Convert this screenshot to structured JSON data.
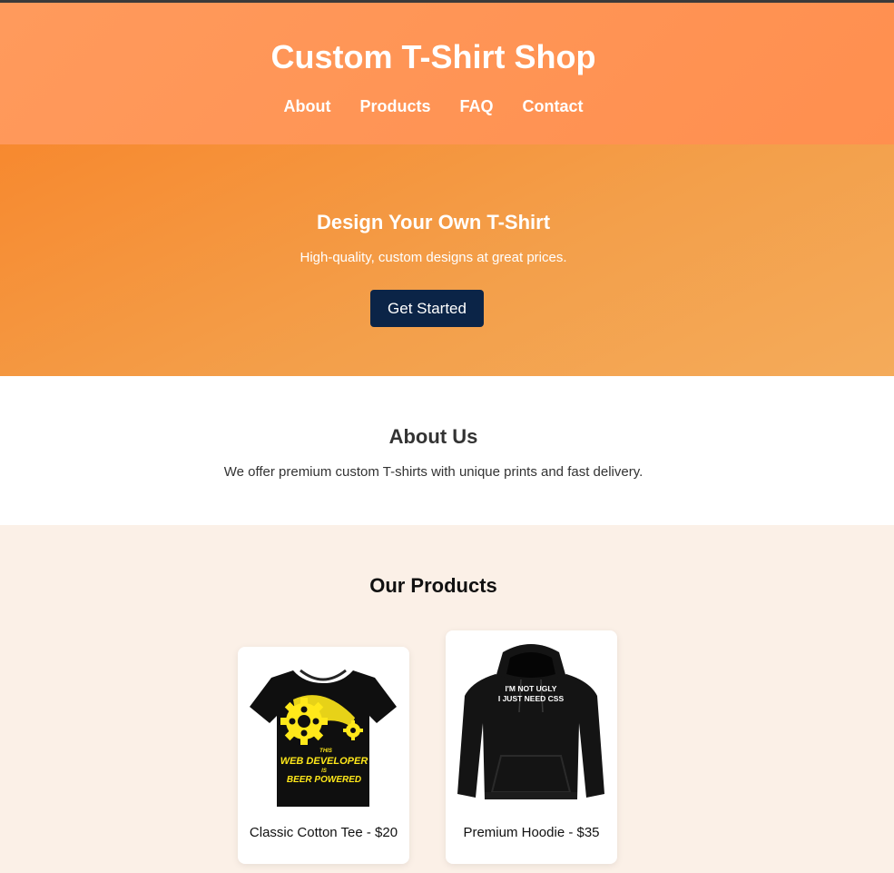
{
  "header": {
    "title": "Custom T-Shirt Shop",
    "nav": [
      "About",
      "Products",
      "FAQ",
      "Contact"
    ]
  },
  "hero": {
    "title": "Design Your Own T-Shirt",
    "subtitle": "High-quality, custom designs at great prices.",
    "cta_label": "Get Started"
  },
  "about": {
    "title": "About Us",
    "text": "We offer premium custom T-shirts with unique prints and fast delivery."
  },
  "products": {
    "title": "Our Products",
    "items": [
      {
        "label": "Classic Cotton Tee - $20",
        "image": "tshirt-image",
        "print_text": [
          "THIS",
          "WEB DEVELOPER",
          "IS",
          "BEER POWERED"
        ]
      },
      {
        "label": "Premium Hoodie - $35",
        "image": "hoodie-image",
        "print_text": [
          "I'M NOT UGLY",
          "I JUST NEED CSS"
        ]
      }
    ]
  },
  "colors": {
    "header_bg": "#ff9458",
    "hero_bg_start": "#f7892f",
    "hero_bg_end": "#f4ab5a",
    "cta_bg": "#0b2447",
    "products_bg": "#fbf0e7",
    "print_yellow": "#ffe81a"
  }
}
